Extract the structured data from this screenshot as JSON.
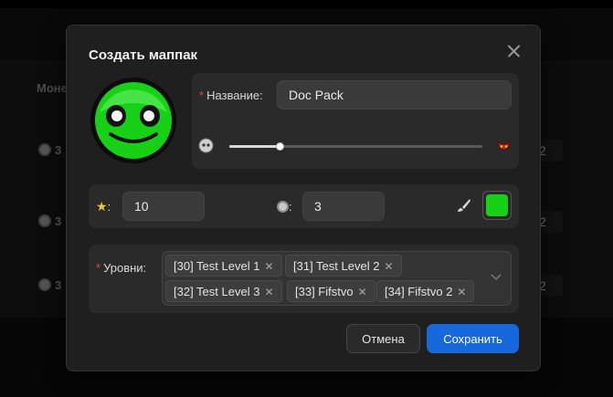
{
  "background": {
    "column_header": "Моне",
    "rows": [
      {
        "coins": "3",
        "badge": "2"
      },
      {
        "coins": "3",
        "badge": "2"
      },
      {
        "coins": "3",
        "badge": "2"
      }
    ]
  },
  "modal": {
    "title": "Создать маппак",
    "name_field": {
      "label": "Название:",
      "value": "Doc Pack"
    },
    "difficulty": {
      "value_fraction": 0.2,
      "min_icon": "easy-face-icon",
      "max_icon": "demon-icon"
    },
    "stars": {
      "label": ":",
      "value": "10"
    },
    "coins": {
      "label": ":",
      "value": "3"
    },
    "color": {
      "icon": "paint-brush-icon",
      "value": "#17d117"
    },
    "levels": {
      "label": "Уровни:",
      "tags": [
        "[30] Test Level 1",
        "[31] Test Level 2",
        "[32] Test Level 3",
        "[33] Fifstvo",
        "[34] Fifstvo 2"
      ],
      "remove_glyph": "✕",
      "dropdown_icon": "chevron-down-icon"
    },
    "buttons": {
      "cancel": "Отмена",
      "save": "Сохранить"
    }
  },
  "colors": {
    "accent": "#1668dc",
    "required": "#e0424c",
    "face": "#17d117"
  }
}
